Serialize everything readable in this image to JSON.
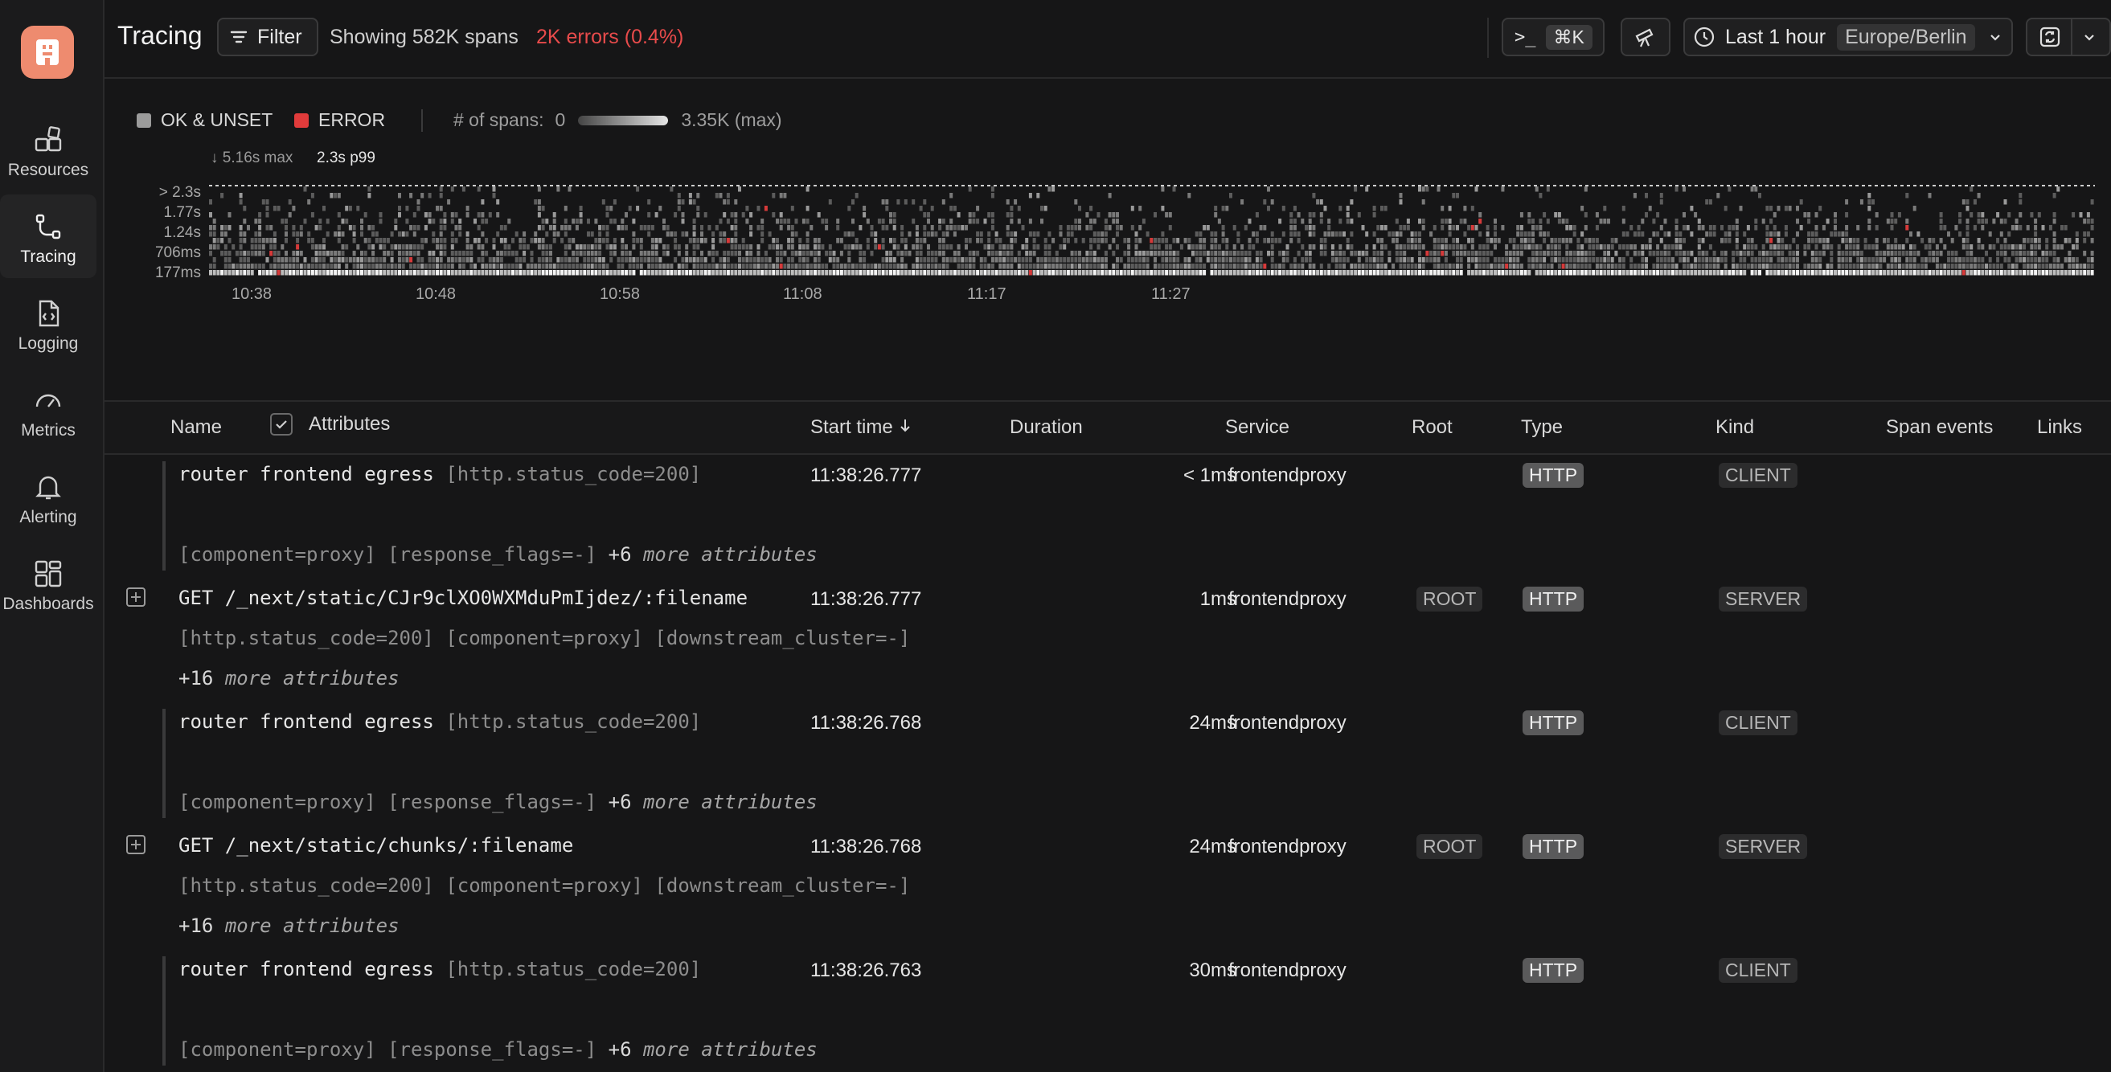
{
  "sidebar": {
    "items": [
      {
        "label": "Resources",
        "icon": "resources-icon"
      },
      {
        "label": "Tracing",
        "icon": "tracing-icon",
        "active": true
      },
      {
        "label": "Logging",
        "icon": "logging-icon"
      },
      {
        "label": "Metrics",
        "icon": "metrics-icon"
      },
      {
        "label": "Alerting",
        "icon": "alerting-icon"
      },
      {
        "label": "Dashboards",
        "icon": "dashboards-icon"
      }
    ]
  },
  "header": {
    "title": "Tracing",
    "filter_label": "Filter",
    "summary": "Showing 582K spans",
    "errors": "2K errors (0.4%)",
    "command_prompt": ">_",
    "command_shortcut": "⌘K",
    "time_range": "Last 1 hour",
    "timezone": "Europe/Berlin"
  },
  "chart_data": {
    "type": "heatmap",
    "legend": [
      {
        "label": "OK & UNSET",
        "color": "#9b9b9b"
      },
      {
        "label": "ERROR",
        "color": "#e03b3b"
      }
    ],
    "count_scale": {
      "label": "# of spans:",
      "min": "0",
      "max": "3.35K (max)"
    },
    "duration_max": "5.16s max",
    "p99": "2.3s p99",
    "y_ticks": [
      "> 2.3s",
      "1.77s",
      "1.24s",
      "706ms",
      "177ms"
    ],
    "x_ticks": [
      "10:38",
      "10:48",
      "10:58",
      "11:08",
      "11:17",
      "11:27"
    ]
  },
  "table": {
    "columns": {
      "name": "Name",
      "attributes": "Attributes",
      "start_time": "Start time",
      "duration": "Duration",
      "service": "Service",
      "root": "Root",
      "type": "Type",
      "kind": "Kind",
      "span_events": "Span events",
      "links": "Links"
    },
    "rows": [
      {
        "name": "router frontend egress",
        "attr1": "[http.status_code=200]",
        "attr2": "[component=proxy] [response_flags=-]",
        "more_count": "+6",
        "more_label": "more attributes",
        "start": "11:38:26.777",
        "duration": "< 1ms",
        "service": "frontendproxy",
        "root": "",
        "type": "HTTP",
        "kind": "CLIENT",
        "expandable": false
      },
      {
        "name": "GET /_next/static/CJr9clXO0WXMduPmIjdez/:filename",
        "attr1": "[http.status_code=200] [component=proxy]",
        "attr2": "[downstream_cluster=-]",
        "more_count": "+16",
        "more_label": "more attributes",
        "start": "11:38:26.777",
        "duration": "1ms",
        "service": "frontendproxy",
        "root": "ROOT",
        "type": "HTTP",
        "kind": "SERVER",
        "expandable": true
      },
      {
        "name": "router frontend egress",
        "attr1": "[http.status_code=200]",
        "attr2": "[component=proxy] [response_flags=-]",
        "more_count": "+6",
        "more_label": "more attributes",
        "start": "11:38:26.768",
        "duration": "24ms",
        "service": "frontendproxy",
        "root": "",
        "type": "HTTP",
        "kind": "CLIENT",
        "expandable": false
      },
      {
        "name": "GET /_next/static/chunks/:filename",
        "attr1": "[http.status_code=200] [component=proxy]",
        "attr2": "[downstream_cluster=-]",
        "more_count": "+16",
        "more_label": "more attributes",
        "start": "11:38:26.768",
        "duration": "24ms",
        "service": "frontendproxy",
        "root": "ROOT",
        "type": "HTTP",
        "kind": "SERVER",
        "expandable": true
      },
      {
        "name": "router frontend egress",
        "attr1": "[http.status_code=200]",
        "attr2": "[component=proxy] [response_flags=-]",
        "more_count": "+6",
        "more_label": "more attributes",
        "start": "11:38:26.763",
        "duration": "30ms",
        "service": "frontendproxy",
        "root": "",
        "type": "HTTP",
        "kind": "CLIENT",
        "expandable": false
      }
    ]
  }
}
